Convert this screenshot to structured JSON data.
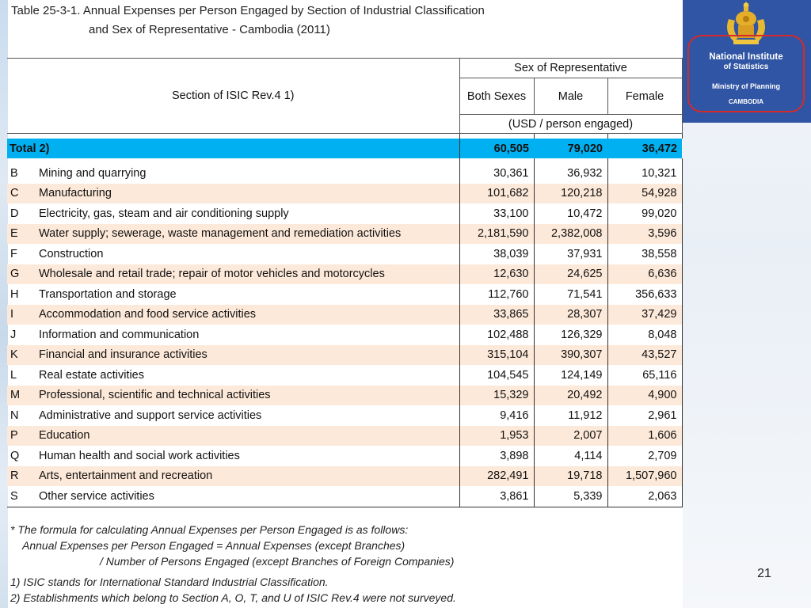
{
  "title": {
    "line1": "Table 25-3-1. Annual Expenses per Person Engaged by Section of Industrial Classification",
    "line2": "and Sex of Representative - Cambodia (2011)"
  },
  "logo": {
    "line1": "National Institute",
    "line2": "of Statistics",
    "line3": "Ministry of Planning",
    "line4": "CAMBODIA",
    "bg_color": "#2f55a4",
    "ring_color": "#d52a2a"
  },
  "header": {
    "section": "Section of ISIC Rev.4  1)",
    "sex_group": "Sex of Representative",
    "both": "Both Sexes",
    "male": "Male",
    "female": "Female",
    "unit": "(USD / person engaged)"
  },
  "total": {
    "label": "Total  2)",
    "both": "60,505",
    "male": "79,020",
    "female": "36,472",
    "color": "#00b0f0"
  },
  "rows": [
    {
      "code": "B",
      "name": "Mining and quarrying",
      "both": "30,361",
      "male": "36,932",
      "female": "10,321"
    },
    {
      "code": "C",
      "name": "Manufacturing",
      "both": "101,682",
      "male": "120,218",
      "female": "54,928"
    },
    {
      "code": "D",
      "name": "Electricity, gas, steam and air conditioning supply",
      "both": "33,100",
      "male": "10,472",
      "female": "99,020"
    },
    {
      "code": "E",
      "name": "Water supply; sewerage, waste management and remediation activities",
      "both": "2,181,590",
      "male": "2,382,008",
      "female": "3,596"
    },
    {
      "code": "F",
      "name": "Construction",
      "both": "38,039",
      "male": "37,931",
      "female": "38,558"
    },
    {
      "code": "G",
      "name": "Wholesale and retail trade; repair of motor vehicles and motorcycles",
      "both": "12,630",
      "male": "24,625",
      "female": "6,636"
    },
    {
      "code": "H",
      "name": "Transportation and storage",
      "both": "112,760",
      "male": "71,541",
      "female": "356,633"
    },
    {
      "code": "I",
      "name": "Accommodation and food service activities",
      "both": "33,865",
      "male": "28,307",
      "female": "37,429"
    },
    {
      "code": "J",
      "name": "Information and communication",
      "both": "102,488",
      "male": "126,329",
      "female": "8,048"
    },
    {
      "code": "K",
      "name": "Financial and insurance activities",
      "both": "315,104",
      "male": "390,307",
      "female": "43,527"
    },
    {
      "code": "L",
      "name": "Real estate activities",
      "both": "104,545",
      "male": "124,149",
      "female": "65,116"
    },
    {
      "code": "M",
      "name": "Professional, scientific and technical activities",
      "both": "15,329",
      "male": "20,492",
      "female": "4,900"
    },
    {
      "code": "N",
      "name": "Administrative and support service activities",
      "both": "9,416",
      "male": "11,912",
      "female": "2,961"
    },
    {
      "code": "P",
      "name": "Education",
      "both": "1,953",
      "male": "2,007",
      "female": "1,606"
    },
    {
      "code": "Q",
      "name": "Human health and social work activities",
      "both": "3,898",
      "male": "4,114",
      "female": "2,709"
    },
    {
      "code": "R",
      "name": "Arts, entertainment and recreation",
      "both": "282,491",
      "male": "19,718",
      "female": "1,507,960"
    },
    {
      "code": "S",
      "name": "Other service activities",
      "both": "3,861",
      "male": "5,339",
      "female": "2,063"
    }
  ],
  "footnotes": {
    "formula1": "* The formula for calculating Annual Expenses per Person Engaged is as follows:",
    "formula2": "Annual Expenses per Person Engaged = Annual Expenses (except Branches)",
    "formula3": "/ Number of Persons Engaged (except Branches of Foreign Companies)",
    "note1": "1) ISIC stands for International Standard Industrial Classification.",
    "note2": "2) Establishments which belong to Section A, O, T, and U of ISIC Rev.4 were not surveyed."
  },
  "row_alt_color": "#fde9d9",
  "page_number": "21"
}
